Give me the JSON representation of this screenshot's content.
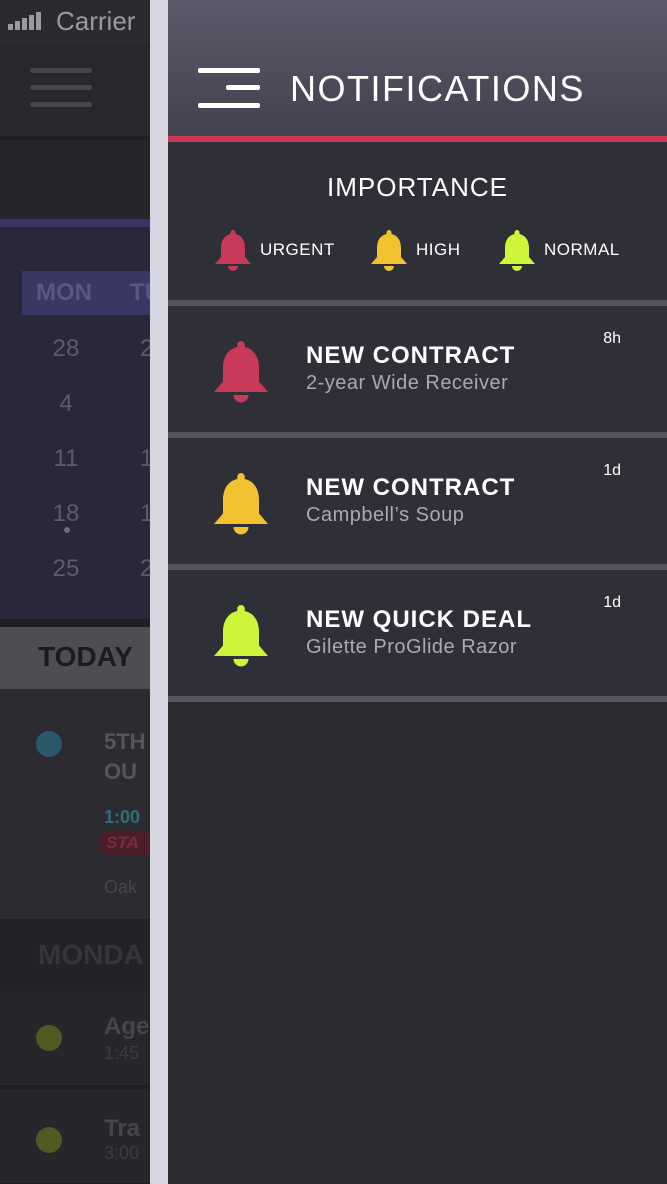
{
  "status_bar": {
    "carrier": "Carrier"
  },
  "background": {
    "day_header": {
      "mon": "MON",
      "tue": "TU"
    },
    "dates": [
      "28",
      "4",
      "11",
      "18",
      "25"
    ],
    "dates_col2": [
      "2",
      "",
      "1",
      "1",
      "2"
    ],
    "today_label": "TODAY",
    "event": {
      "title_line1": "5TH",
      "title_line2": "OU",
      "time": "1:00",
      "badge": "STA",
      "location": "Oak"
    },
    "monday_label": "MONDA",
    "rows": [
      {
        "title": "Age",
        "time": "1:45"
      },
      {
        "title": "Tra",
        "time": "3:00"
      }
    ]
  },
  "drawer": {
    "title": "NOTIFICATIONS",
    "accent_color": "#c93a58",
    "importance": {
      "heading": "IMPORTANCE",
      "levels": [
        {
          "label": "URGENT",
          "color": "#c93a58",
          "icon": "bell-icon"
        },
        {
          "label": "HIGH",
          "color": "#f2c230",
          "icon": "bell-icon"
        },
        {
          "label": "NORMAL",
          "color": "#cdf53a",
          "icon": "bell-icon"
        }
      ]
    },
    "notifications": [
      {
        "title": "NEW CONTRACT",
        "subtitle": "2-year Wide Receiver",
        "time": "8h",
        "level": "URGENT",
        "color": "#c93a58"
      },
      {
        "title": "NEW CONTRACT",
        "subtitle": "Campbell’s Soup",
        "time": "1d",
        "level": "HIGH",
        "color": "#f2c230"
      },
      {
        "title": "NEW QUICK DEAL",
        "subtitle": "Gilette ProGlide Razor",
        "time": "1d",
        "level": "NORMAL",
        "color": "#cdf53a"
      }
    ]
  }
}
